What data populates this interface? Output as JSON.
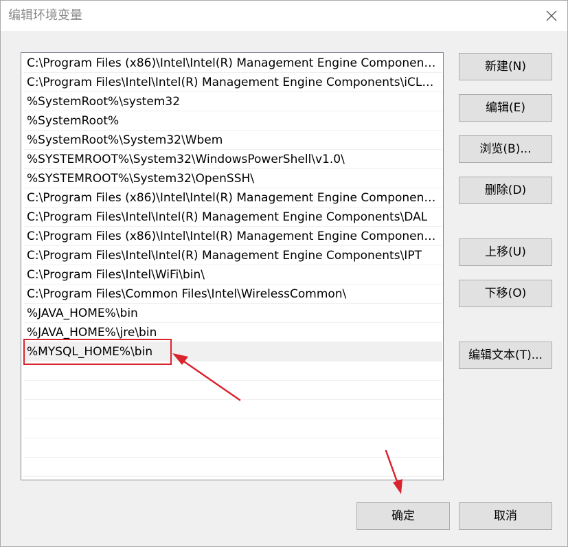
{
  "window": {
    "title": "编辑环境变量"
  },
  "path_list": [
    "C:\\Program Files (x86)\\Intel\\Intel(R) Management Engine Componen…",
    "C:\\Program Files\\Intel\\Intel(R) Management Engine Components\\iCL…",
    "%SystemRoot%\\system32",
    "%SystemRoot%",
    "%SystemRoot%\\System32\\Wbem",
    "%SYSTEMROOT%\\System32\\WindowsPowerShell\\v1.0\\",
    "%SYSTEMROOT%\\System32\\OpenSSH\\",
    "C:\\Program Files (x86)\\Intel\\Intel(R) Management Engine Componen…",
    "C:\\Program Files\\Intel\\Intel(R) Management Engine Components\\DAL",
    "C:\\Program Files (x86)\\Intel\\Intel(R) Management Engine Componen…",
    "C:\\Program Files\\Intel\\Intel(R) Management Engine Components\\IPT",
    "C:\\Program Files\\Intel\\WiFi\\bin\\",
    "C:\\Program Files\\Common Files\\Intel\\WirelessCommon\\",
    "%JAVA_HOME%\\bin",
    "%JAVA_HOME%\\jre\\bin",
    "%MYSQL_HOME%\\bin",
    "",
    "",
    "",
    "",
    "",
    ""
  ],
  "side_buttons": {
    "new": "新建(N)",
    "edit": "编辑(E)",
    "browse": "浏览(B)...",
    "delete": "删除(D)",
    "move_up": "上移(U)",
    "move_down": "下移(O)",
    "edit_text": "编辑文本(T)..."
  },
  "bottom_buttons": {
    "ok": "确定",
    "cancel": "取消"
  },
  "colors": {
    "annotation_red": "#d9232d",
    "selected_row": "#f0f0f0"
  }
}
